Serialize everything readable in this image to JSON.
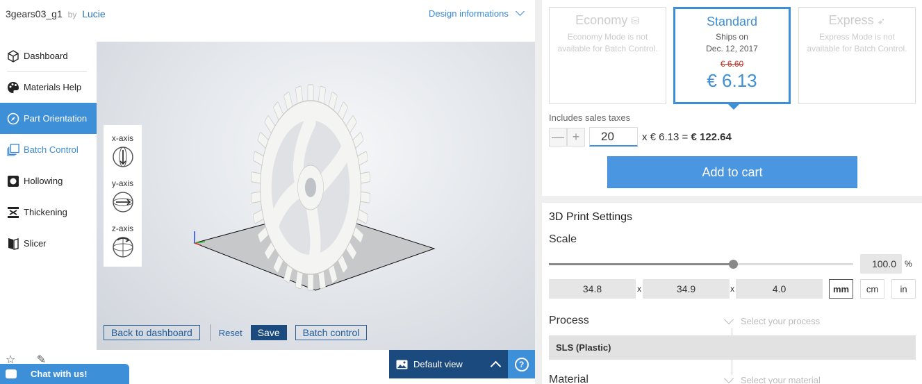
{
  "header": {
    "design_name": "3gears03_g1",
    "by": "by",
    "author": "Lucie",
    "design_info_link": "Design informations"
  },
  "sidebar": {
    "items": [
      {
        "label": "Dashboard",
        "icon": "cube-icon"
      },
      {
        "label": "Materials Help",
        "icon": "palette-icon"
      },
      {
        "label": "Part Orientation",
        "icon": "compass-icon"
      },
      {
        "label": "Batch Control",
        "icon": "stack-icon"
      },
      {
        "label": "Hollowing",
        "icon": "hollow-square-icon"
      },
      {
        "label": "Thickening",
        "icon": "thickening-icon"
      },
      {
        "label": "Slicer",
        "icon": "slicer-icon"
      }
    ]
  },
  "axis_controls": {
    "x_label": "x-axis",
    "y_label": "y-axis",
    "z_label": "z-axis"
  },
  "viewport_actions": {
    "back": "Back to dashboard",
    "reset": "Reset",
    "save": "Save",
    "batch": "Batch control",
    "default_view": "Default view",
    "help": "?"
  },
  "chat": {
    "label": "Chat with us!"
  },
  "shipping": {
    "economy": {
      "title": "Economy",
      "desc": "Economy Mode is not available for Batch Control."
    },
    "standard": {
      "title": "Standard",
      "ships_on": "Ships on",
      "date": "Dec. 12, 2017",
      "old_price": "€ 6.60",
      "price": "€ 6.13"
    },
    "express": {
      "title": "Express",
      "desc": "Express Mode is not available for Batch Control."
    }
  },
  "order": {
    "taxes_note": "Includes sales taxes",
    "minus": "—",
    "plus": "+",
    "quantity": "20",
    "unit_expr": "x € 6.13 = ",
    "total": "€ 122.64",
    "add_to_cart": "Add to cart"
  },
  "settings": {
    "title": "3D Print Settings",
    "scale_label": "Scale",
    "scale_percent": 100,
    "scale_value": "100.0",
    "scale_unit": "%",
    "dims": {
      "x": "34.8",
      "y": "34.9",
      "z": "4.0",
      "sep": "x"
    },
    "units": [
      "mm",
      "cm",
      "in"
    ],
    "active_unit": "mm",
    "process_label": "Process",
    "process_hint": "Select your process",
    "process_value": "SLS (Plastic)",
    "material_label": "Material",
    "material_hint": "Select your material"
  },
  "colors": {
    "accent": "#3d8fd8",
    "dark_accent": "#1b4a7e",
    "old_price": "#c0392b"
  }
}
